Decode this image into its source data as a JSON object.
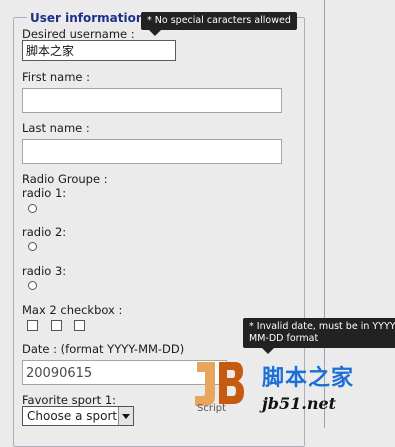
{
  "form": {
    "legend": "User informations",
    "username": {
      "label": "Desired username :",
      "value": "脚本之家"
    },
    "firstname": {
      "label": "First name :",
      "value": ""
    },
    "lastname": {
      "label": "Last name :",
      "value": ""
    },
    "radio_group": {
      "label": "Radio Groupe :",
      "options": [
        "radio 1:",
        "radio 2:",
        "radio 3:"
      ]
    },
    "checkbox_group": {
      "label": "Max 2 checkbox :"
    },
    "date": {
      "label": "Date : (format YYYY-MM-DD)",
      "value": "20090615"
    },
    "sport": {
      "label": "Favorite sport 1:",
      "selected": "Choose a sport"
    }
  },
  "tooltips": {
    "username": "* No special caracters allowed",
    "date_line1": "* Invalid date, must be in YYYY",
    "date_line2": "MM-DD format"
  },
  "watermark": {
    "cn": "脚本之家",
    "url": "jb51.net",
    "script": "Script"
  }
}
